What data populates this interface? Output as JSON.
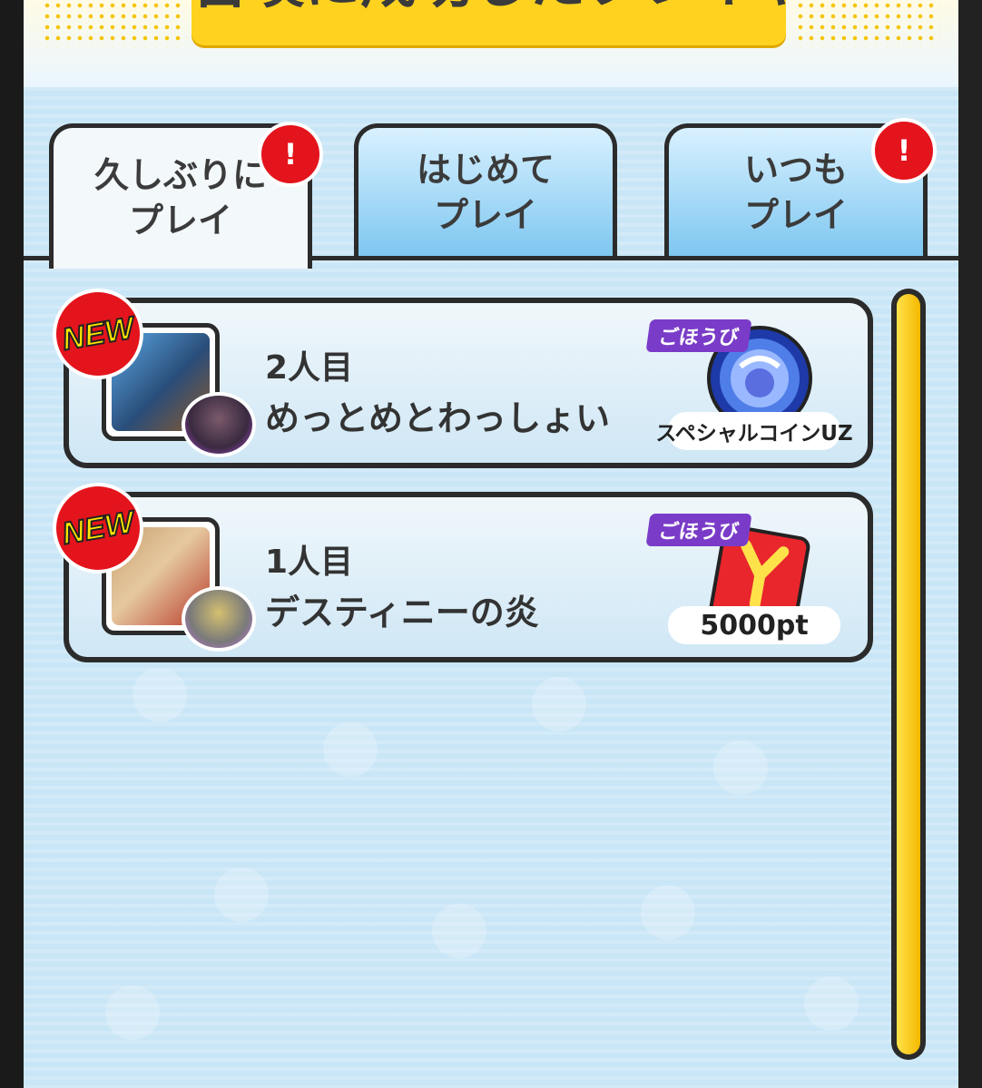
{
  "header": {
    "title": "召喚に成功したプレイヤー"
  },
  "tabs": [
    {
      "line1": "久しぶりに",
      "line2": "プレイ",
      "active": true,
      "badge": "!"
    },
    {
      "line1": "はじめて",
      "line2": "プレイ",
      "active": false,
      "badge": ""
    },
    {
      "line1": "いつも",
      "line2": "プレイ",
      "active": false,
      "badge": "!"
    }
  ],
  "players": [
    {
      "new_badge": "NEW",
      "order": "2人目",
      "name": "めっとめとわっしょい",
      "reward_label": "ごほうび",
      "reward_name": "スペシャルコインUZ",
      "reward_icon": "special-coin-uz-icon"
    },
    {
      "new_badge": "NEW",
      "order": "1人目",
      "name": "デスティニーの炎",
      "reward_label": "ごほうび",
      "reward_name": "5000pt",
      "reward_icon": "y-point-card-icon"
    }
  ],
  "colors": {
    "accent": "#ffd21f",
    "badge_red": "#e4141c",
    "reward_purple": "#7a3cc8",
    "scroll_thumb": "#f5c000"
  }
}
